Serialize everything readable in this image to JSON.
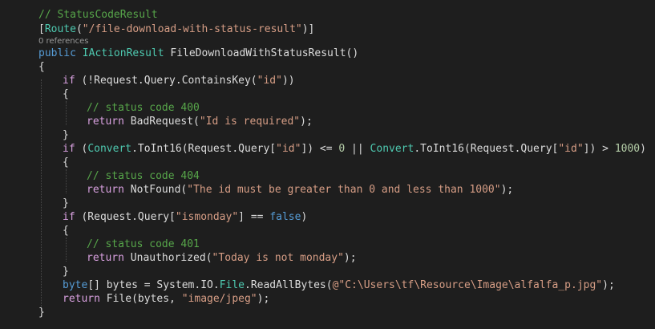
{
  "codelens": "0 references",
  "lines": [
    {
      "indent": 0,
      "tokens": [
        {
          "t": "// StatusCodeResult",
          "c": "com"
        }
      ]
    },
    {
      "indent": 0,
      "tokens": [
        {
          "t": "[",
          "c": "plain"
        },
        {
          "t": "Route",
          "c": "type"
        },
        {
          "t": "(",
          "c": "plain"
        },
        {
          "t": "\"/file-download-with-status-result\"",
          "c": "str"
        },
        {
          "t": ")]",
          "c": "plain"
        }
      ]
    },
    {
      "indent": 0,
      "tokens": [
        {
          "t": "public",
          "c": "kw"
        },
        {
          "t": " ",
          "c": "plain"
        },
        {
          "t": "IActionResult",
          "c": "type"
        },
        {
          "t": " FileDownloadWithStatusResult()",
          "c": "plain"
        }
      ]
    },
    {
      "indent": 0,
      "tokens": [
        {
          "t": "{",
          "c": "plain"
        }
      ]
    },
    {
      "indent": 1,
      "tokens": [
        {
          "t": "if",
          "c": "kwc"
        },
        {
          "t": " (!Request.Query.ContainsKey(",
          "c": "plain"
        },
        {
          "t": "\"id\"",
          "c": "str"
        },
        {
          "t": "))",
          "c": "plain"
        }
      ]
    },
    {
      "indent": 1,
      "tokens": [
        {
          "t": "{",
          "c": "plain"
        }
      ]
    },
    {
      "indent": 2,
      "tokens": [
        {
          "t": "// status code 400",
          "c": "com"
        }
      ]
    },
    {
      "indent": 2,
      "tokens": [
        {
          "t": "return",
          "c": "kwc"
        },
        {
          "t": " BadRequest(",
          "c": "plain"
        },
        {
          "t": "\"Id is required\"",
          "c": "str"
        },
        {
          "t": ");",
          "c": "plain"
        }
      ]
    },
    {
      "indent": 1,
      "tokens": [
        {
          "t": "}",
          "c": "plain"
        }
      ]
    },
    {
      "indent": 1,
      "tokens": [
        {
          "t": "if",
          "c": "kwc"
        },
        {
          "t": " (",
          "c": "plain"
        },
        {
          "t": "Convert",
          "c": "type"
        },
        {
          "t": ".ToInt16(Request.Query[",
          "c": "plain"
        },
        {
          "t": "\"id\"",
          "c": "str"
        },
        {
          "t": "]) <= ",
          "c": "plain"
        },
        {
          "t": "0",
          "c": "num"
        },
        {
          "t": " || ",
          "c": "plain"
        },
        {
          "t": "Convert",
          "c": "type"
        },
        {
          "t": ".ToInt16(Request.Query[",
          "c": "plain"
        },
        {
          "t": "\"id\"",
          "c": "str"
        },
        {
          "t": "]) > ",
          "c": "plain"
        },
        {
          "t": "1000",
          "c": "num"
        },
        {
          "t": ")",
          "c": "plain"
        }
      ]
    },
    {
      "indent": 1,
      "tokens": [
        {
          "t": "{",
          "c": "plain"
        }
      ]
    },
    {
      "indent": 2,
      "tokens": [
        {
          "t": "// status code 404",
          "c": "com"
        }
      ]
    },
    {
      "indent": 2,
      "tokens": [
        {
          "t": "return",
          "c": "kwc"
        },
        {
          "t": " NotFound(",
          "c": "plain"
        },
        {
          "t": "\"The id must be greater than 0 and less than 1000\"",
          "c": "str"
        },
        {
          "t": ");",
          "c": "plain"
        }
      ]
    },
    {
      "indent": 1,
      "tokens": [
        {
          "t": "}",
          "c": "plain"
        }
      ]
    },
    {
      "indent": 1,
      "tokens": [
        {
          "t": "if",
          "c": "kwc"
        },
        {
          "t": " (Request.Query[",
          "c": "plain"
        },
        {
          "t": "\"ismonday\"",
          "c": "str"
        },
        {
          "t": "] == ",
          "c": "plain"
        },
        {
          "t": "false",
          "c": "kw"
        },
        {
          "t": ")",
          "c": "plain"
        }
      ]
    },
    {
      "indent": 1,
      "tokens": [
        {
          "t": "{",
          "c": "plain"
        }
      ]
    },
    {
      "indent": 2,
      "tokens": [
        {
          "t": "// status code 401",
          "c": "com"
        }
      ]
    },
    {
      "indent": 2,
      "tokens": [
        {
          "t": "return",
          "c": "kwc"
        },
        {
          "t": " Unauthorized(",
          "c": "plain"
        },
        {
          "t": "\"Today is not monday\"",
          "c": "str"
        },
        {
          "t": ");",
          "c": "plain"
        }
      ]
    },
    {
      "indent": 1,
      "tokens": [
        {
          "t": "}",
          "c": "plain"
        }
      ]
    },
    {
      "indent": 1,
      "tokens": [
        {
          "t": "byte",
          "c": "kw"
        },
        {
          "t": "[] bytes = System.IO.",
          "c": "plain"
        },
        {
          "t": "File",
          "c": "type"
        },
        {
          "t": ".ReadAllBytes(",
          "c": "plain"
        },
        {
          "t": "@\"C:\\Users\\tf\\Resource\\Image\\alfalfa_p.jpg\"",
          "c": "str"
        },
        {
          "t": ");",
          "c": "plain"
        }
      ]
    },
    {
      "indent": 1,
      "tokens": [
        {
          "t": "return",
          "c": "kwc"
        },
        {
          "t": " File(bytes, ",
          "c": "plain"
        },
        {
          "t": "\"image/jpeg\"",
          "c": "str"
        },
        {
          "t": ");",
          "c": "plain"
        }
      ]
    },
    {
      "indent": 0,
      "tokens": [
        {
          "t": "}",
          "c": "plain"
        }
      ]
    }
  ]
}
